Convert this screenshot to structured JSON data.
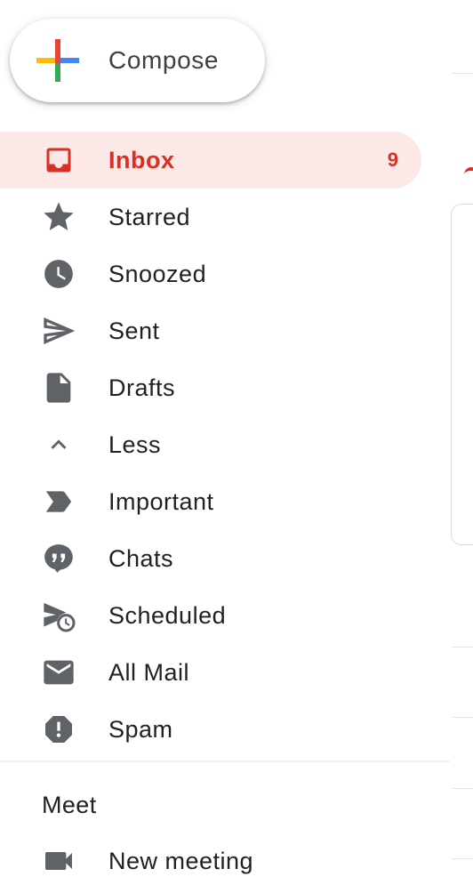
{
  "compose": {
    "label": "Compose"
  },
  "nav": {
    "items": [
      {
        "label": "Inbox",
        "icon": "inbox-icon",
        "count": "9",
        "active": true
      },
      {
        "label": "Starred",
        "icon": "star-icon"
      },
      {
        "label": "Snoozed",
        "icon": "clock-icon"
      },
      {
        "label": "Sent",
        "icon": "send-icon"
      },
      {
        "label": "Drafts",
        "icon": "draft-icon"
      },
      {
        "label": "Less",
        "icon": "chevron-up-icon"
      },
      {
        "label": "Important",
        "icon": "important-label-icon"
      },
      {
        "label": "Chats",
        "icon": "chat-quote-icon"
      },
      {
        "label": "Scheduled",
        "icon": "scheduled-send-icon"
      },
      {
        "label": "All Mail",
        "icon": "mail-icon"
      },
      {
        "label": "Spam",
        "icon": "report-icon"
      }
    ]
  },
  "meet": {
    "heading": "Meet",
    "items": [
      {
        "label": "New meeting",
        "icon": "videocam-icon"
      }
    ]
  },
  "colors": {
    "accent": "#d93025",
    "active_bg": "#fce8e6",
    "icon": "#5f6368",
    "text": "#202124"
  }
}
